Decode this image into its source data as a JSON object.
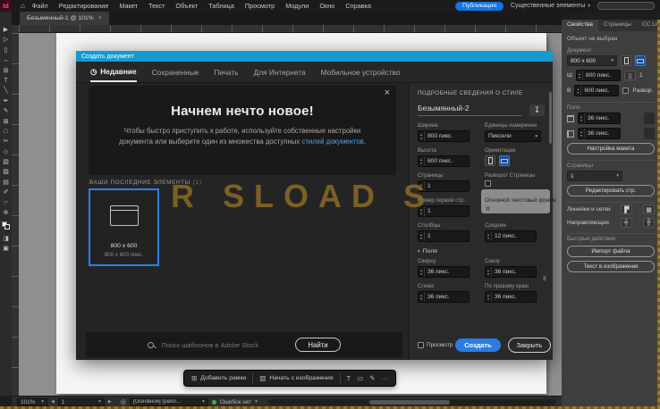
{
  "icons": {
    "logo": "Id",
    "home": "⌂",
    "chevron": "▾",
    "close": "×",
    "clock": "◷",
    "download": "↧",
    "link": "∞",
    "more": "···",
    "prev": "◀",
    "next": "▶",
    "preflight": "◎",
    "text_tool": "T",
    "frame": "▭",
    "pen": "✎",
    "add_frames": "⊞",
    "image": "▨",
    "rulers_grids_a": "▛",
    "rulers_grids_b": "▦",
    "guides_a": "╪",
    "guides_b": "╫"
  },
  "menubar": {
    "items": [
      "Файл",
      "Редактирование",
      "Макет",
      "Текст",
      "Объект",
      "Таблица",
      "Просмотр",
      "Модули",
      "Окно",
      "Справка"
    ],
    "publish": "Публикация",
    "workspace": "Существенные элементы"
  },
  "doc_tab": {
    "title": "Безымянный-1 @ 101%"
  },
  "tools": [
    "▶",
    "▷",
    "▯",
    "↔",
    "⊞",
    "T",
    "╲",
    "✒",
    "✎",
    "⊠",
    "□",
    "✂",
    "◇",
    "▧",
    "▨",
    "▤",
    "✐",
    "☞",
    "⊕",
    "◨",
    "▣"
  ],
  "ruler_labels": [
    "50",
    "100",
    "150",
    "200",
    "250",
    "300",
    "350",
    "400",
    "450",
    "500",
    "550",
    "600",
    "650",
    "700",
    "750",
    "800",
    "850"
  ],
  "panel": {
    "tabs": [
      "Свойства",
      "Страницы",
      "CC Lib"
    ],
    "no_selection": "Объект не выбран",
    "document_label": "Документ",
    "preset": "800 x 600",
    "w_label": "Ш",
    "w_value": "800 пикс.",
    "h_label": "В",
    "h_value": "600 пикс.",
    "pages_inline": "1",
    "facing_short": "Развор.",
    "margins_label": "Поля",
    "margin_value": "36 пикс.",
    "adjust_layout": "Настройка макета",
    "pages_label": "Страницы",
    "pages_value": "1",
    "edit_pages": "Редактировать стр.",
    "rulers_grids": "Линейки и сетки",
    "guides": "Направляющие",
    "quick_actions": "Быстрые действия",
    "import_file": "Импорт файла",
    "text_to_image": "Текст в изображение"
  },
  "dialog": {
    "title": "Создать документ",
    "tabs": [
      "Недавние",
      "Сохраненные",
      "Печать",
      "Для Интернета",
      "Мобильное устройство"
    ],
    "hero": {
      "heading": "Начнем нечто новое!",
      "line1": "Чтобы быстро приступить к работе, используйте собственные настройки",
      "line2": "документа или выберите один из множества доступных ",
      "link": "стилей документов",
      "suffix": "."
    },
    "recent_heading": "ВАШИ ПОСЛЕДНИЕ ЭЛЕМЕНТЫ",
    "recent_count": "(1)",
    "card": {
      "title": "800 x 600",
      "subtitle": "800 x 600 пикс."
    },
    "search_placeholder": "Поиск шаблонов в Adobe Stock",
    "find_button": "Найти",
    "details": {
      "heading": "ПОДРОБНЫЕ СВЕДЕНИЯ О СТИЛЕ",
      "name": "Безымянный-2",
      "width_label": "Ширина",
      "width_value": "800 пикс.",
      "units_label": "Единицы измерения",
      "units_value": "Пиксели",
      "height_label": "Высота",
      "height_value": "600 пикс.",
      "orientation_label": "Ориентация",
      "pages_label": "Страницы",
      "pages_value": "1",
      "facing_label": "Разворот Страницы",
      "start_label": "Номер первой стр.",
      "start_value": "1",
      "primary_frame_label": "Основной текстовый фрейм",
      "columns_label": "Столбцы",
      "columns_value": "1",
      "gutter_label": "Средник",
      "gutter_value": "12 пикс.",
      "margins_label": "Поля",
      "top_label": "Сверху",
      "top_value": "36 пикс.",
      "bottom_label": "Снизу",
      "bottom_value": "36 пикс.",
      "left_label": "Слева",
      "left_value": "36 пикс.",
      "right_label": "По правому краю",
      "right_value": "36 пикс.",
      "preview_label": "Просмотр",
      "create": "Создать",
      "close": "Закрыть"
    }
  },
  "taskbar": {
    "add_frames": "Добавить рамки",
    "start_image": "Начать с изображения"
  },
  "statusbar": {
    "zoom": "101%",
    "page": "1",
    "preflight": "[Основной] (рабо…",
    "no_errors": "Ошибок нет"
  },
  "watermark": "R SLOAD S",
  "colors": {
    "accent_blue": "#1473e6",
    "dialog_titlebar": "#1699cf",
    "watermark_gold": "#8e6e24",
    "no_error_green": "#3fae49"
  }
}
